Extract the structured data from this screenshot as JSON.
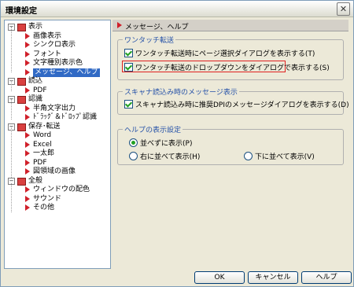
{
  "window": {
    "title": "環境設定"
  },
  "tree": {
    "items": [
      {
        "label": "表示",
        "level": 0,
        "expander": "−",
        "selected": false,
        "icon": "folder-icon"
      },
      {
        "label": "画像表示",
        "level": 1,
        "icon": "arrow-icon"
      },
      {
        "label": "シンクロ表示",
        "level": 1,
        "icon": "arrow-icon"
      },
      {
        "label": "フォント",
        "level": 1,
        "icon": "arrow-icon"
      },
      {
        "label": "文字種別表示色",
        "level": 1,
        "icon": "arrow-icon"
      },
      {
        "label": "メッセージ、ヘルプ",
        "level": 1,
        "selected": true,
        "icon": "arrow-icon"
      },
      {
        "label": "読込",
        "level": 0,
        "expander": "−",
        "icon": "folder-icon"
      },
      {
        "label": "PDF",
        "level": 1,
        "icon": "arrow-icon"
      },
      {
        "label": "認識",
        "level": 0,
        "expander": "−",
        "icon": "folder-icon"
      },
      {
        "label": "半角文字出力",
        "level": 1,
        "icon": "arrow-icon"
      },
      {
        "label": "ﾄﾞﾗｯｸﾞ＆ﾄﾞﾛｯﾌﾟ認識",
        "level": 1,
        "icon": "arrow-icon"
      },
      {
        "label": "保存･転送",
        "level": 0,
        "expander": "−",
        "icon": "folder-icon"
      },
      {
        "label": "Word",
        "level": 1,
        "icon": "arrow-icon"
      },
      {
        "label": "Excel",
        "level": 1,
        "icon": "arrow-icon"
      },
      {
        "label": "一太郎",
        "level": 1,
        "icon": "arrow-icon"
      },
      {
        "label": "PDF",
        "level": 1,
        "icon": "arrow-icon"
      },
      {
        "label": "図領域の画像",
        "level": 1,
        "icon": "arrow-icon"
      },
      {
        "label": "全般",
        "level": 0,
        "expander": "−",
        "icon": "folder-icon"
      },
      {
        "label": "ウィンドウの配色",
        "level": 1,
        "icon": "arrow-icon"
      },
      {
        "label": "サウンド",
        "level": 1,
        "icon": "arrow-icon"
      },
      {
        "label": "その他",
        "level": 1,
        "icon": "arrow-icon"
      }
    ]
  },
  "panel": {
    "header": "メッセージ、ヘルプ",
    "group1": {
      "legend": "ワンタッチ転送",
      "opt1": "ワンタッチ転送時にページ選択ダイアログを表示する(T)",
      "opt2": "ワンタッチ転送のドロップダウンをダイアログで表示する(S)"
    },
    "group2": {
      "legend": "スキャナ読込み時のメッセージ表示",
      "opt1": "スキャナ読込み時に推奨DPIのメッセージダイアログを表示する(D)"
    },
    "group3": {
      "legend": "ヘルプの表示設定",
      "radio1": "並べずに表示(P)",
      "radio2": "右に並べて表示(H)",
      "radio3": "下に並べて表示(V)",
      "selected": "radio1"
    }
  },
  "buttons": {
    "ok": "OK",
    "cancel": "キャンセル",
    "help": "ヘルプ"
  },
  "colors": {
    "accent": "#316ac5",
    "highlight": "#e02020",
    "legend": "#2652a8",
    "treeArrow": "#d0202a"
  }
}
